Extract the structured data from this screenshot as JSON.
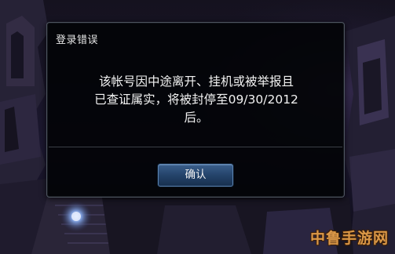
{
  "dialog": {
    "title": "登录错误",
    "message_lines": [
      "该帐号因中途离开、挂机或被举报且",
      "已查证属实，将被封停至09/30/2012",
      "后。"
    ],
    "confirm_label": "确认"
  },
  "watermark": {
    "text": "中鲁手游网"
  },
  "colors": {
    "dialog_background": "#030408",
    "dialog_border": "#4e5560",
    "button_accent": "#2a4a74",
    "watermark": "#f0a64a"
  }
}
